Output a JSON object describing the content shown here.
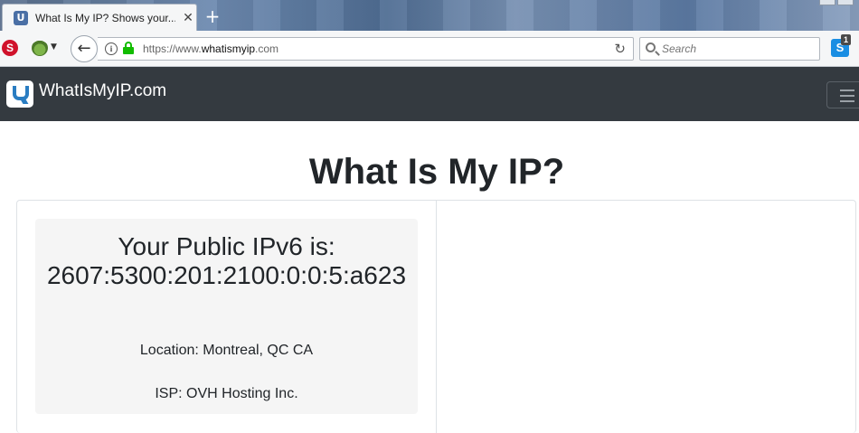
{
  "browser": {
    "tab": {
      "favicon": "whatismyip-favicon",
      "title": "What Is My IP? Shows your...",
      "close_glyph": "✕"
    },
    "new_tab_glyph": "+",
    "toolbar": {
      "back_glyph": "←",
      "url_prefix": "https://www.",
      "url_domain": "whatismyip",
      "url_suffix": ".com",
      "reload_glyph": "↻",
      "search_placeholder": "Search",
      "stop_label": "S",
      "skype_label": "S",
      "skype_badge": "1"
    }
  },
  "site": {
    "brand": "WhatIsMyIP.com",
    "accent": "#2a7dc2",
    "header_bg": "#343a40"
  },
  "main": {
    "title": "What Is My IP?",
    "ip_heading": "Your Public IPv6 is:",
    "ip_value": "2607:5300:201:2100:0:0:5:a623",
    "location": "Location: Montreal, QC CA",
    "isp": "ISP: OVH Hosting Inc."
  }
}
